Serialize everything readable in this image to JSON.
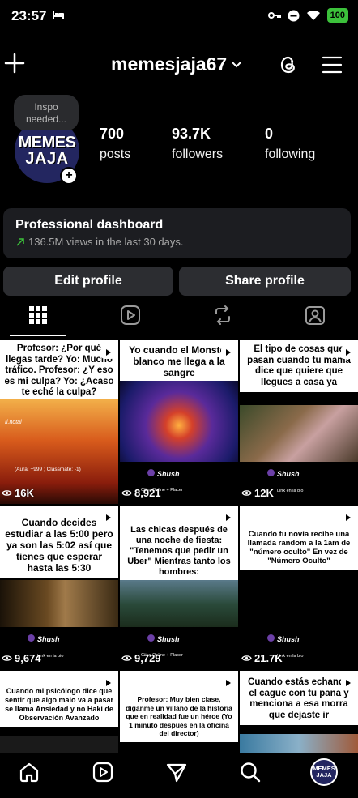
{
  "status": {
    "time": "23:57",
    "battery": "100"
  },
  "header": {
    "username": "memesjaja67"
  },
  "profile": {
    "note": "Inspo needed...",
    "avatar_line1": "MEMES",
    "avatar_line2": "JAJA",
    "stats": [
      {
        "value": "700",
        "label": "posts"
      },
      {
        "value": "93.7K",
        "label": "followers"
      },
      {
        "value": "0",
        "label": "following"
      }
    ]
  },
  "dashboard": {
    "title": "Professional dashboard",
    "subtitle": "136.5M views in the last 30 days."
  },
  "buttons": {
    "edit": "Edit profile",
    "share": "Share profile"
  },
  "tabs": [
    "grid-icon",
    "reels-icon",
    "reposts-icon",
    "tagged-icon"
  ],
  "posts": [
    {
      "caption": "Profesor: ¿Por qué llegas tarde? Yo: Mucho tráfico. Profesor: ¿Y eso es mi culpa? Yo: ¿Acaso te eché la culpa?",
      "views": "16K",
      "overlay": "(Aura: +999 ; Classmate: -1)",
      "watermark": "Il.notai"
    },
    {
      "caption": "Yo cuando el Monster blanco me llega a la sangre",
      "views": "8,921",
      "brand": "Shush",
      "tag": "Citas Online + Placer"
    },
    {
      "caption": "El tipo de cosas que pasan cuando tu mamá dice que quiere que llegues a casa ya",
      "views": "12K",
      "brand": "Shush",
      "tag": "Link en la bio"
    },
    {
      "caption": "Cuando decides estudiar a las 5:00 pero ya son las 5:02 así que tienes que esperar hasta las 5:30",
      "views": "9,674",
      "brand": "Shush",
      "tag": "Link en la bio"
    },
    {
      "caption": "Las chicas después de una noche de fiesta: \"Tenemos que pedir un Uber\" Mientras tanto los hombres:",
      "views": "9,729",
      "brand": "Shush",
      "tag": "Citas Online + Placer"
    },
    {
      "caption": "Cuando tu novia recibe una llamada random a la 1am de \"número oculto\" En vez de \"Número Oculto\"",
      "views": "21.7K",
      "brand": "Shush",
      "tag": "Link en la bio"
    },
    {
      "caption": "Cuando mi psicólogo dice que sentir que algo malo va a pasar se llama Ansiedad y no Haki de Observación Avanzado"
    },
    {
      "caption": "Profesor: Muy bien clase, díganme un villano de la historia que en realidad fue un héroe (Yo 1 minuto después en la oficina del director)"
    },
    {
      "caption": "Cuando estás echando el cague con tu pana y menciona a esa morra que dejaste ir"
    }
  ],
  "colors": {
    "card": "#1c1d21",
    "button": "#2c2d31",
    "accent_green": "#3cc13b",
    "avatar_bg": "#232660"
  }
}
